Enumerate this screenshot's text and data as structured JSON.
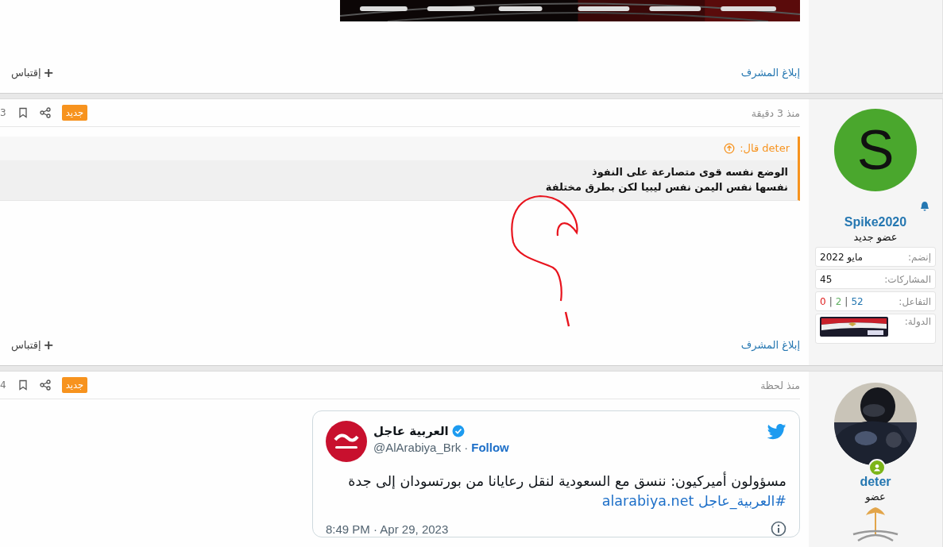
{
  "previous_post": {
    "kind": "picture",
    "report_link": "إبلاغ المشرف",
    "quote_button": {
      "icon": "+",
      "label": "إقتباس"
    }
  },
  "post": {
    "user": {
      "avatar_letter": "S",
      "name": "Spike2020",
      "rank": "عضو جديد",
      "stats": [
        {
          "kind": "text",
          "label": "إنضم:",
          "value": "مايو 2022"
        },
        {
          "kind": "text",
          "label": "المشاركات:",
          "value": "45"
        },
        {
          "kind": "reactions",
          "label": "التفاعل:",
          "separator": "|",
          "values": [
            {
              "text": "52",
              "color": "#2577b1"
            },
            {
              "text": "2",
              "color": "#63b265"
            },
            {
              "text": "0",
              "color": "#e02020"
            }
          ]
        },
        {
          "kind": "flag",
          "label": "الدولة:"
        }
      ]
    },
    "time": "منذ 3 دقيقة",
    "badge": "جديد",
    "number": "3",
    "quote": {
      "author": "deter",
      "said": "قال:",
      "lines": [
        "الوضع نفسه قوى متصارعة على النفوذ",
        "نفسها نفس اليمن نفس ليبيا لكن بطرق مختلفة"
      ]
    },
    "report_link": "إبلاغ المشرف",
    "quote_button": {
      "icon": "+",
      "label": "إقتباس"
    }
  },
  "last_post": {
    "user": {
      "name": "deter",
      "rank": "عضو",
      "online": true
    },
    "time": "منذ لحظة",
    "badge": "جديد",
    "number": "4",
    "tweet": {
      "name": "العربية عاجل",
      "verified": true,
      "handle": "@AlArabiya_Brk",
      "dot": "·",
      "follow": "Follow",
      "text": "مسؤولون أميركيون: ننسق مع السعودية لنقل رعايانا من بورتسودان إلى جدة",
      "hashtag": "#العربية_عاجل",
      "link": "alarabiya.net",
      "date": "8:49 PM · Apr 29, 2023"
    }
  }
}
